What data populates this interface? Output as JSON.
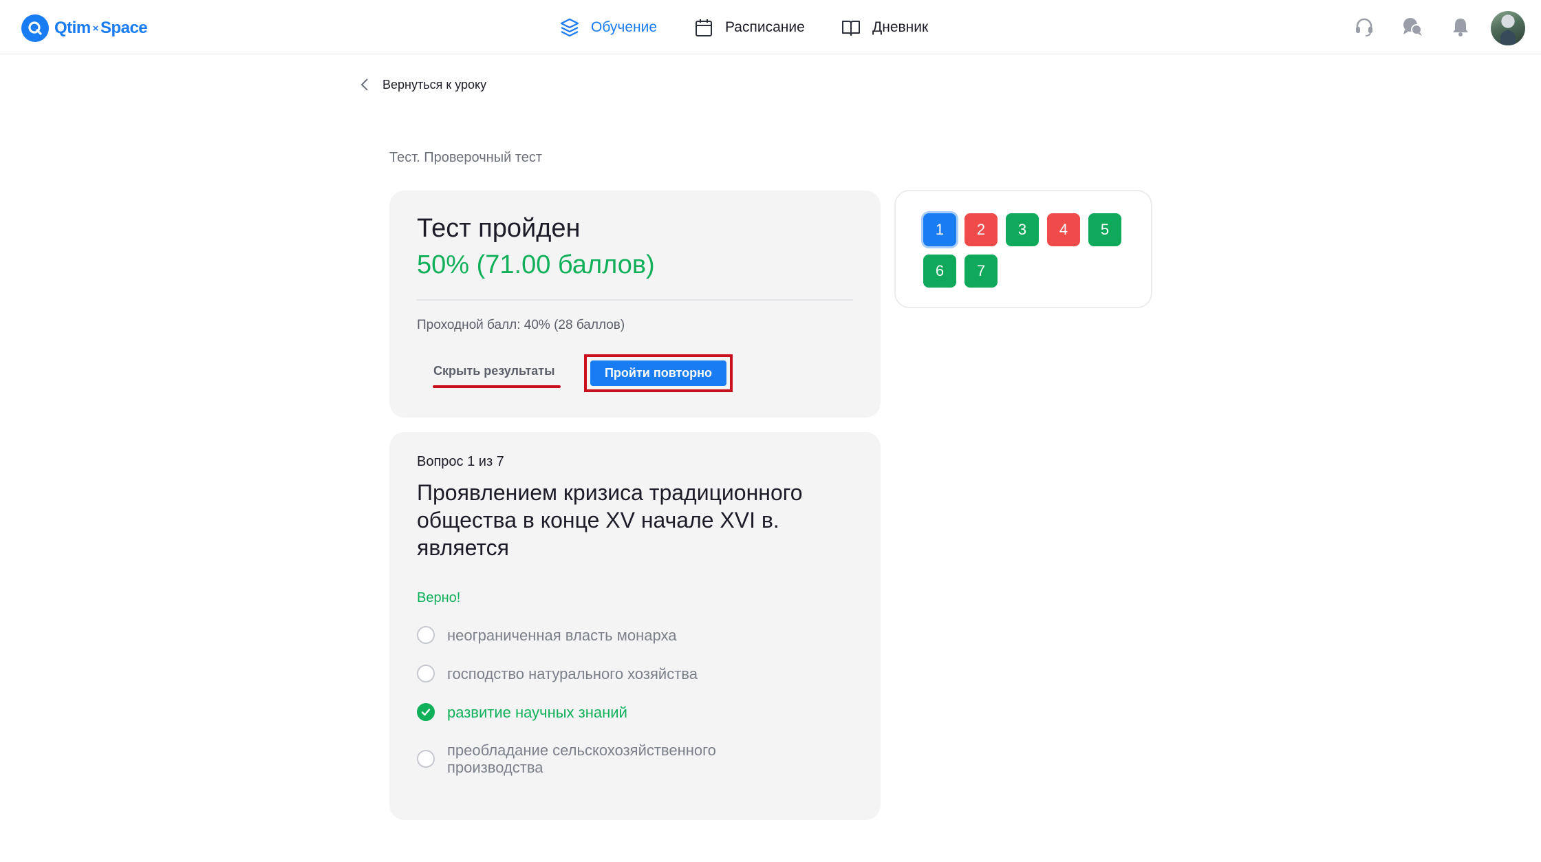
{
  "header": {
    "logo": {
      "left": "Qtim",
      "sep": "×",
      "right": "Space"
    },
    "nav": [
      {
        "label": "Обучение",
        "icon": "layers-icon",
        "active": true
      },
      {
        "label": "Расписание",
        "icon": "calendar-icon",
        "active": false
      },
      {
        "label": "Дневник",
        "icon": "book-icon",
        "active": false
      }
    ],
    "icons": [
      "headset-icon",
      "chat-icon",
      "bell-icon",
      "avatar"
    ]
  },
  "back_link": "Вернуться к уроку",
  "breadcrumb": "Тест. Проверочный тест",
  "result": {
    "title": "Тест пройден",
    "score": "50% (71.00 баллов)",
    "passing": "Проходной балл: 40% (28 баллов)",
    "hide_button": "Скрыть результаты",
    "retake_button": "Пройти повторно"
  },
  "question_nav": [
    {
      "label": "1",
      "state": "current"
    },
    {
      "label": "2",
      "state": "wrong"
    },
    {
      "label": "3",
      "state": "correct"
    },
    {
      "label": "4",
      "state": "wrong"
    },
    {
      "label": "5",
      "state": "correct"
    },
    {
      "label": "6",
      "state": "correct"
    },
    {
      "label": "7",
      "state": "correct"
    }
  ],
  "question": {
    "counter": "Вопрос 1 из 7",
    "text": "Проявлением кризиса традиционного общества в конце XV начале XVI в. является",
    "status": "Верно!",
    "options": [
      {
        "label": "неограниченная власть монарха",
        "selected": false
      },
      {
        "label": "господство натурального хозяйства",
        "selected": false
      },
      {
        "label": "развитие научных знаний",
        "selected": true
      },
      {
        "label": "преобладание сельскохозяйственного производства",
        "selected": false
      }
    ]
  },
  "colors": {
    "accent": "#1a7cf2",
    "correct": "#10a85a",
    "wrong": "#ef4b4b",
    "highlight": "#c8101c"
  }
}
